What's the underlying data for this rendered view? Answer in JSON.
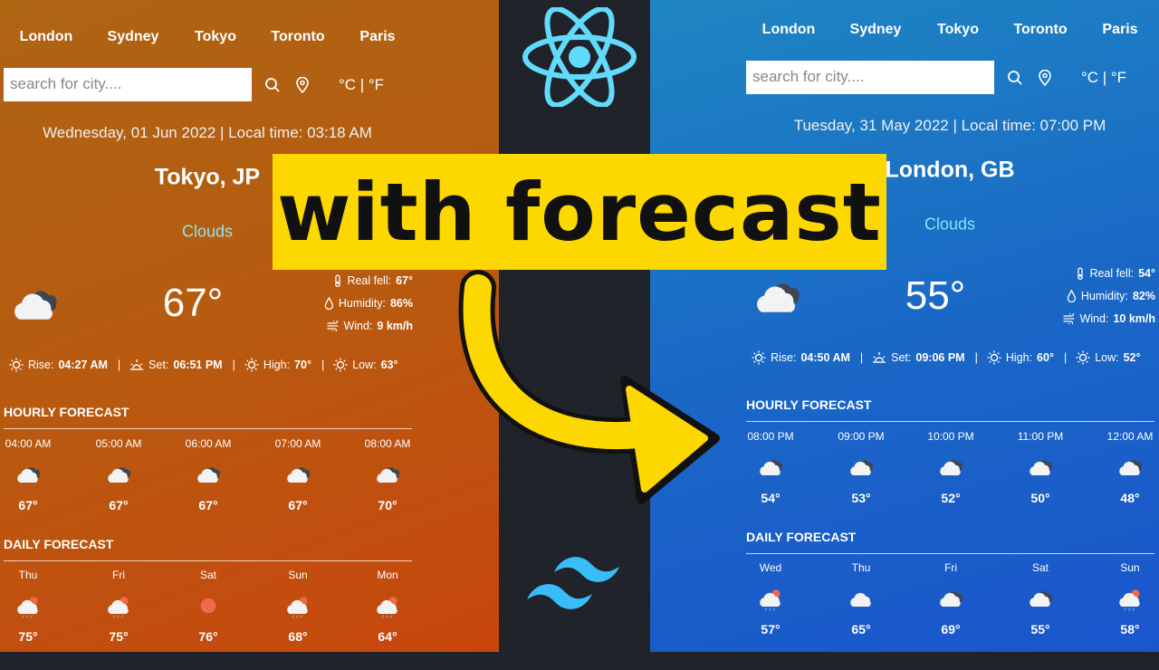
{
  "units_label": "°C | °F",
  "banner_text": "with forecast",
  "accent": {
    "left_condition": "#8fe3f0",
    "right_condition": "#7ee8f5",
    "banner": "#fdd700",
    "react": "#61dafb",
    "tailwind": "#38bdf8"
  },
  "left": {
    "nav": [
      "London",
      "Sydney",
      "Tokyo",
      "Toronto",
      "Paris"
    ],
    "search_placeholder": "search for city....",
    "date": "Wednesday, 01 Jun 2022 | Local time: 03:18 AM",
    "city": "Tokyo, JP",
    "condition": "Clouds",
    "icon": "clouds",
    "temp": "67°",
    "details": {
      "real_feel_label": "Real fell:",
      "real_feel": "67°",
      "humidity_label": "Humidity:",
      "humidity": "86%",
      "wind_label": "Wind:",
      "wind": "9 km/h"
    },
    "sun": {
      "rise_label": "Rise:",
      "rise": "04:27 AM",
      "set_label": "Set:",
      "set": "06:51 PM",
      "high_label": "High:",
      "high": "70°",
      "low_label": "Low:",
      "low": "63°"
    },
    "hourly_title": "HOURLY FORECAST",
    "hourly": [
      {
        "title": "04:00 AM",
        "icon": "clouds",
        "temp": "67°"
      },
      {
        "title": "05:00 AM",
        "icon": "clouds",
        "temp": "67°"
      },
      {
        "title": "06:00 AM",
        "icon": "clouds",
        "temp": "67°"
      },
      {
        "title": "07:00 AM",
        "icon": "clouds",
        "temp": "67°"
      },
      {
        "title": "08:00 AM",
        "icon": "clouds",
        "temp": "70°"
      }
    ],
    "daily_title": "DAILY FORECAST",
    "daily": [
      {
        "title": "Thu",
        "icon": "rain-sun",
        "temp": "75°"
      },
      {
        "title": "Fri",
        "icon": "rain-sun",
        "temp": "75°"
      },
      {
        "title": "Sat",
        "icon": "sun",
        "temp": "76°"
      },
      {
        "title": "Sun",
        "icon": "rain-sun",
        "temp": "68°"
      },
      {
        "title": "Mon",
        "icon": "rain-sun",
        "temp": "64°"
      }
    ]
  },
  "right": {
    "nav": [
      "London",
      "Sydney",
      "Tokyo",
      "Toronto",
      "Paris"
    ],
    "search_placeholder": "search for city....",
    "date": "Tuesday, 31 May 2022 | Local time: 07:00 PM",
    "city": "London, GB",
    "condition": "Clouds",
    "icon": "clouds",
    "temp": "55°",
    "details": {
      "real_feel_label": "Real fell:",
      "real_feel": "54°",
      "humidity_label": "Humidity:",
      "humidity": "82%",
      "wind_label": "Wind:",
      "wind": "10 km/h"
    },
    "sun": {
      "rise_label": "Rise:",
      "rise": "04:50 AM",
      "set_label": "Set:",
      "set": "09:06 PM",
      "high_label": "High:",
      "high": "60°",
      "low_label": "Low:",
      "low": "52°"
    },
    "hourly_title": "HOURLY FORECAST",
    "hourly": [
      {
        "title": "08:00 PM",
        "icon": "clouds",
        "temp": "54°"
      },
      {
        "title": "09:00 PM",
        "icon": "clouds",
        "temp": "53°"
      },
      {
        "title": "10:00 PM",
        "icon": "clouds",
        "temp": "52°"
      },
      {
        "title": "11:00 PM",
        "icon": "clouds",
        "temp": "50°"
      },
      {
        "title": "12:00 AM",
        "icon": "clouds",
        "temp": "48°"
      }
    ],
    "daily_title": "DAILY FORECAST",
    "daily": [
      {
        "title": "Wed",
        "icon": "rain-sun",
        "temp": "57°"
      },
      {
        "title": "Thu",
        "icon": "cloud",
        "temp": "65°"
      },
      {
        "title": "Fri",
        "icon": "clouds",
        "temp": "69°"
      },
      {
        "title": "Sat",
        "icon": "clouds",
        "temp": "55°"
      },
      {
        "title": "Sun",
        "icon": "rain-sun",
        "temp": "58°"
      }
    ]
  }
}
